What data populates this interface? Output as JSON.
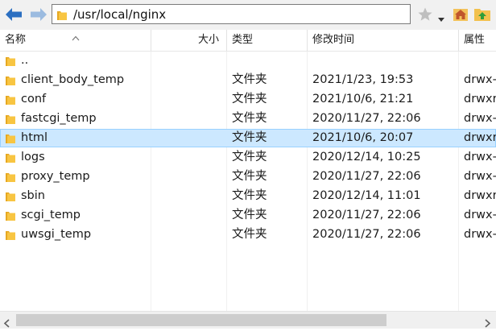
{
  "address": {
    "path": "/usr/local/nginx"
  },
  "toolbar": {
    "icons": [
      "back-arrow-icon",
      "forward-arrow-icon",
      "folder-icon",
      "star-icon",
      "dropdown-icon",
      "home-icon",
      "up-icon"
    ]
  },
  "columns": {
    "name": "名称",
    "size": "大小",
    "type": "类型",
    "modified": "修改时间",
    "attrs": "属性"
  },
  "rows": [
    {
      "name": "..",
      "type": "",
      "modified": "",
      "attrs": ""
    },
    {
      "name": "client_body_temp",
      "type": "文件夹",
      "modified": "2021/1/23, 19:53",
      "attrs": "drwx-"
    },
    {
      "name": "conf",
      "type": "文件夹",
      "modified": "2021/10/6, 21:21",
      "attrs": "drwxr"
    },
    {
      "name": "fastcgi_temp",
      "type": "文件夹",
      "modified": "2020/11/27, 22:06",
      "attrs": "drwx-"
    },
    {
      "name": "html",
      "type": "文件夹",
      "modified": "2021/10/6, 20:07",
      "attrs": "drwxr"
    },
    {
      "name": "logs",
      "type": "文件夹",
      "modified": "2020/12/14, 10:25",
      "attrs": "drwx-"
    },
    {
      "name": "proxy_temp",
      "type": "文件夹",
      "modified": "2020/11/27, 22:06",
      "attrs": "drwx-"
    },
    {
      "name": "sbin",
      "type": "文件夹",
      "modified": "2020/12/14, 11:01",
      "attrs": "drwxr"
    },
    {
      "name": "scgi_temp",
      "type": "文件夹",
      "modified": "2020/11/27, 22:06",
      "attrs": "drwx-"
    },
    {
      "name": "uwsgi_temp",
      "type": "文件夹",
      "modified": "2020/11/27, 22:06",
      "attrs": "drwx-"
    }
  ],
  "selected_row": 4,
  "colors": {
    "selection_bg": "#cce8ff",
    "selection_border": "#99d1ff",
    "folder": "#f8c542",
    "nav_arrow": "#2b6fc1"
  }
}
